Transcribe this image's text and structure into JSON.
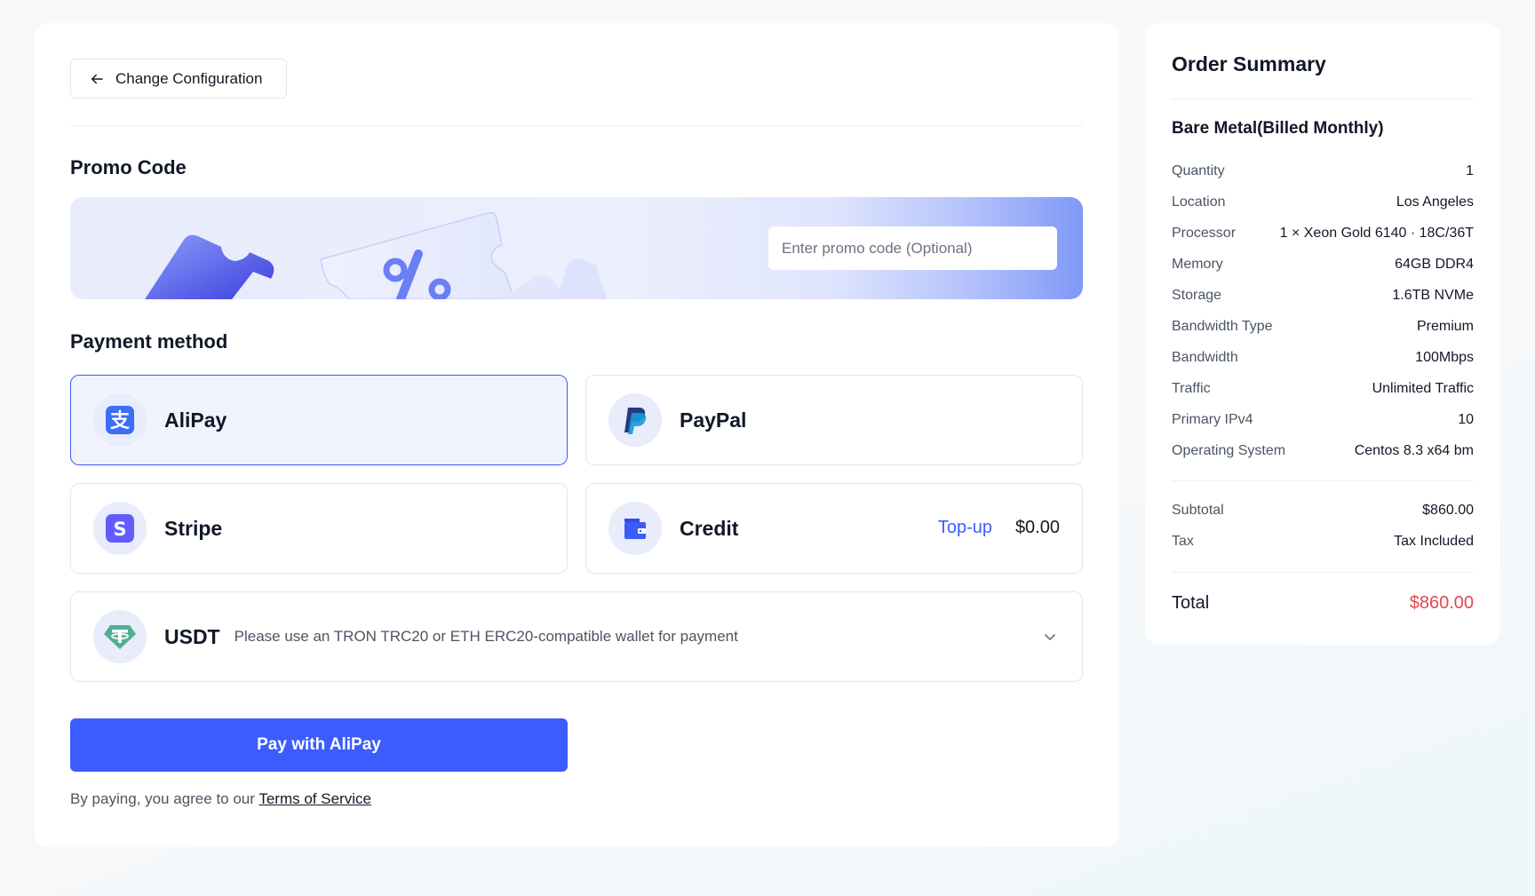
{
  "header": {
    "back_label": "Change Configuration"
  },
  "promo": {
    "title": "Promo Code",
    "placeholder": "Enter promo code (Optional)"
  },
  "payment": {
    "title": "Payment method",
    "methods": [
      {
        "label": "AliPay",
        "icon": "alipay-icon",
        "selected": true
      },
      {
        "label": "PayPal",
        "icon": "paypal-icon",
        "selected": false
      },
      {
        "label": "Stripe",
        "icon": "stripe-icon",
        "selected": false
      },
      {
        "label": "Credit",
        "icon": "wallet-icon",
        "selected": false,
        "topup_label": "Top-up",
        "balance": "$0.00"
      }
    ],
    "usdt": {
      "label": "USDT",
      "note": "Please use an TRON TRC20 or ETH ERC20-compatible wallet for payment",
      "icon": "tether-icon"
    },
    "pay_button": "Pay with AliPay",
    "agree_text": "By paying, you agree to our",
    "terms_link": "Terms of Service"
  },
  "summary": {
    "title": "Order Summary",
    "product": "Bare Metal(Billed Monthly)",
    "rows": [
      {
        "k": "Quantity",
        "v": "1"
      },
      {
        "k": "Location",
        "v": "Los Angeles"
      },
      {
        "k": "Processor",
        "v": "1 × Xeon Gold 6140 · 18C/36T"
      },
      {
        "k": "Memory",
        "v": "64GB DDR4"
      },
      {
        "k": "Storage",
        "v": "1.6TB NVMe"
      },
      {
        "k": "Bandwidth Type",
        "v": "Premium"
      },
      {
        "k": "Bandwidth",
        "v": "100Mbps"
      },
      {
        "k": "Traffic",
        "v": "Unlimited Traffic"
      },
      {
        "k": "Primary IPv4",
        "v": "10"
      },
      {
        "k": "Operating System",
        "v": "Centos 8.3 x64 bm"
      }
    ],
    "subtotal_label": "Subtotal",
    "subtotal": "$860.00",
    "tax_label": "Tax",
    "tax": "Tax Included",
    "total_label": "Total",
    "total": "$860.00"
  },
  "colors": {
    "accent": "#3d5cff",
    "total_red": "#e5484d",
    "selected_bg": "#f1f4fe"
  }
}
